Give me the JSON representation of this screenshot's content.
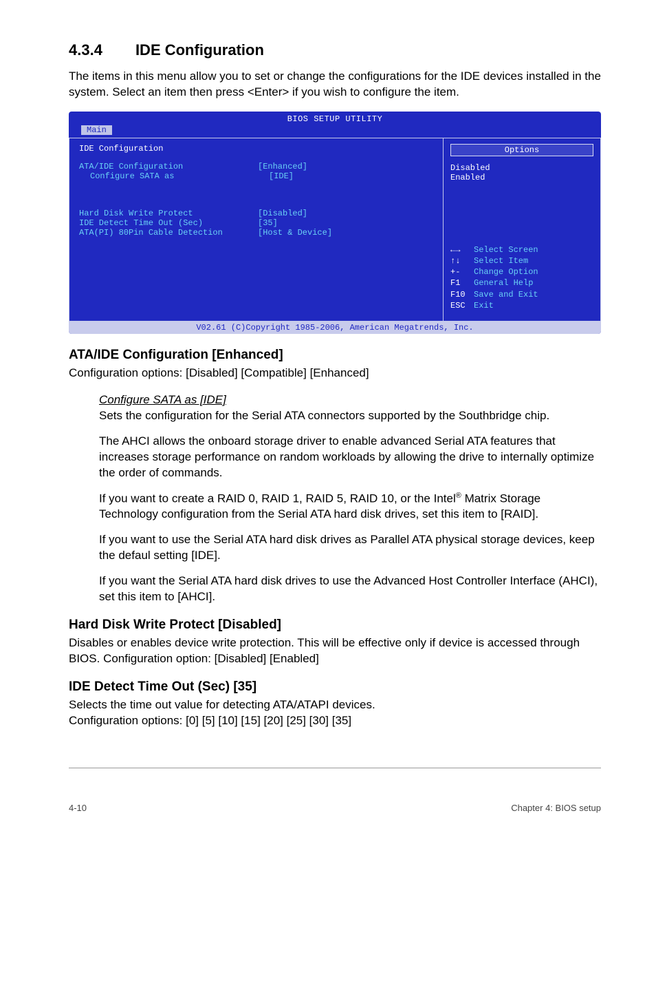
{
  "section": {
    "number": "4.3.4",
    "title": "IDE Configuration",
    "intro": "The items in this menu allow you to set or change the configurations for the IDE devices installed in the system. Select an item then press <Enter> if you wish to configure the item."
  },
  "bios": {
    "title": "BIOS SETUP UTILITY",
    "tab": "Main",
    "left_header": "IDE Configuration",
    "rows1": [
      {
        "k": "ATA/IDE Configuration",
        "v": "[Enhanced]",
        "indent": false
      },
      {
        "k": "Configure SATA as",
        "v": "[IDE]",
        "indent": true
      }
    ],
    "rows2": [
      {
        "k": "Hard Disk Write Protect",
        "v": "[Disabled]"
      },
      {
        "k": "IDE Detect Time Out (Sec)",
        "v": "[35]"
      },
      {
        "k": "ATA(PI) 80Pin Cable Detection",
        "v": "[Host & Device]"
      }
    ],
    "right": {
      "box": "Options",
      "opts": [
        "Disabled",
        "Enabled"
      ],
      "nav": [
        {
          "sym": "←→",
          "label": "Select Screen"
        },
        {
          "sym": "↑↓",
          "label": "Select Item"
        },
        {
          "sym": "+-",
          "label": "Change Option"
        },
        {
          "sym": "F1",
          "label": "General Help"
        },
        {
          "sym": "F10",
          "label": "Save and Exit"
        },
        {
          "sym": "ESC",
          "label": "Exit"
        }
      ]
    },
    "footer": "V02.61 (C)Copyright 1985-2006, American Megatrends, Inc."
  },
  "ata_ide": {
    "heading": "ATA/IDE Configuration [Enhanced]",
    "line": "Configuration options: [Disabled] [Compatible] [Enhanced]",
    "sub_under": "Configure SATA as [IDE]",
    "p1": "Sets the configuration for the Serial ATA connectors supported by the Southbridge chip.",
    "p2": "The AHCI allows the onboard storage driver to enable advanced Serial ATA features that increases storage performance on random workloads by allowing the drive to internally optimize the order of commands.",
    "p3a": "If you want to create a RAID 0, RAID 1, RAID 5,  RAID 10, or the Intel",
    "p3b": " Matrix Storage Technology configuration from the Serial ATA hard disk drives, set this item to [RAID].",
    "p4": "If you want to use the Serial ATA hard disk drives as Parallel ATA physical storage devices, keep the defaul setting [IDE].",
    "p5": "If you want the Serial ATA hard disk drives to use the Advanced Host Controller Interface (AHCI), set this item to [AHCI]."
  },
  "hdwp": {
    "heading": "Hard Disk Write Protect [Disabled]",
    "body": "Disables or enables device write protection. This will be effective only if device is accessed through BIOS. Configuration option: [Disabled] [Enabled]"
  },
  "ide_detect": {
    "heading": "IDE Detect Time Out (Sec) [35]",
    "l1": "Selects the time out value for detecting ATA/ATAPI devices.",
    "l2": "Configuration options: [0] [5] [10] [15] [20] [25] [30] [35]"
  },
  "footer": {
    "left": "4-10",
    "right": "Chapter 4: BIOS setup"
  }
}
